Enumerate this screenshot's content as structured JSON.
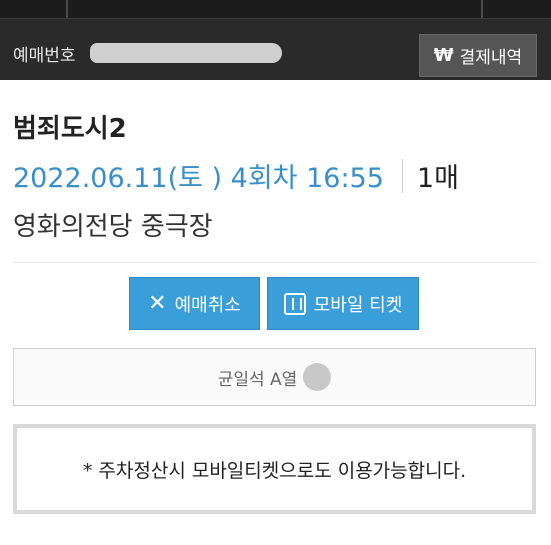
{
  "header": {
    "booking_label": "예매번호",
    "pay_history_label": "결제내역",
    "pay_history_icon": "won-icon"
  },
  "reservation": {
    "title": "범죄도시2",
    "datetime": "2022.06.11(토 ) 4회차 16:55",
    "ticket_count": "1매",
    "venue": "영화의전당 중극장"
  },
  "actions": {
    "cancel_label": "예매취소",
    "cancel_icon": "x-icon",
    "mobile_ticket_label": "모바일 티켓",
    "mobile_ticket_icon": "ticket-icon"
  },
  "seat": {
    "label": "균일석 A열"
  },
  "notice": {
    "text": "* 주차정산시 모바일티켓으로도 이용가능합니다."
  },
  "colors": {
    "header_bg": "#2a2a2a",
    "accent_blue": "#3a9ed9",
    "date_blue": "#3a8fc9"
  }
}
